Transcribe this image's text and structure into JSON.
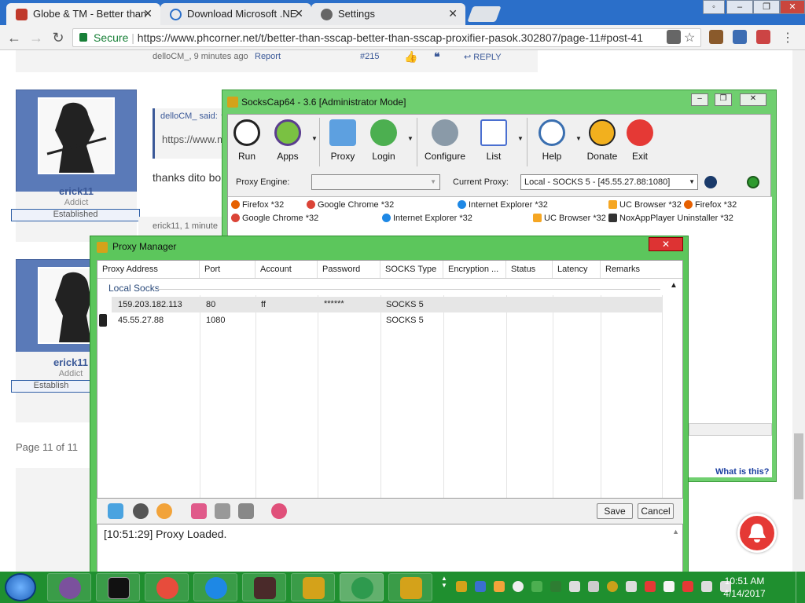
{
  "browser": {
    "tabs": [
      {
        "title": "Globe & TM - Better than",
        "close": "✕"
      },
      {
        "title": "Download Microsoft .NE",
        "close": "✕"
      },
      {
        "title": "Settings",
        "close": "✕"
      }
    ],
    "secure_label": "Secure",
    "url": "https://www.phcorner.net/t/better-than-sscap-better-than-sscap-proxifier-pasok.302807/page-11#post-41"
  },
  "forum": {
    "prev_post_meta": "delloCM_, 9 minutes ago",
    "report": "Report",
    "post_number": "#215",
    "reply": "REPLY",
    "quote_author": "delloCM_ said: ↑",
    "quote_text": "https://www.m",
    "post_text": "thanks dito bo",
    "post_meta": "erick11, 1 minute",
    "user1": {
      "name": "erick11",
      "role": "Addict",
      "badge": "Established"
    },
    "user2": {
      "name": "erick11",
      "role": "Addict",
      "badge": "Establish"
    },
    "pagination": "Page 11 of 11"
  },
  "sockscap": {
    "title": "SocksCap64 - 3.6 [Administrator Mode]",
    "toolbar": [
      "Run",
      "Apps",
      "Proxy",
      "Login",
      "Configure",
      "List",
      "Help",
      "Donate",
      "Exit"
    ],
    "proxy_engine_label": "Proxy Engine:",
    "current_proxy_label": "Current Proxy:",
    "current_proxy_value": "Local - SOCKS 5 - [45.55.27.88:1080]",
    "apps": [
      "Firefox *32",
      "Google Chrome *32",
      "Internet Explorer *32",
      "UC Browser *32",
      "Firefox *32",
      "Google Chrome *32",
      "Internet Explorer *32",
      "UC Browser *32",
      "NoxAppPlayer Uninstaller *32"
    ],
    "what_is_this": "What is this?"
  },
  "proxy_manager": {
    "title": "Proxy Manager",
    "close": "✕",
    "columns": [
      "Proxy Address",
      "Port",
      "Account",
      "Password",
      "SOCKS Type",
      "Encryption ...",
      "Status",
      "Latency",
      "Remarks"
    ],
    "group": "Local Socks",
    "rows": [
      {
        "address": "159.203.182.113",
        "port": "80",
        "account": "ff",
        "password": "******",
        "type": "SOCKS 5"
      },
      {
        "address": "45.55.27.88",
        "port": "1080",
        "account": "",
        "password": "",
        "type": "SOCKS 5"
      }
    ],
    "save": "Save",
    "cancel": "Cancel",
    "log": "[10:51:29]  Proxy Loaded."
  },
  "taskbar": {
    "time": "10:51 AM",
    "date": "4/14/2017"
  },
  "colors": {
    "accent_green": "#5cc65c",
    "forum_blue": "#5a7ab8",
    "secure_green": "#188038"
  }
}
